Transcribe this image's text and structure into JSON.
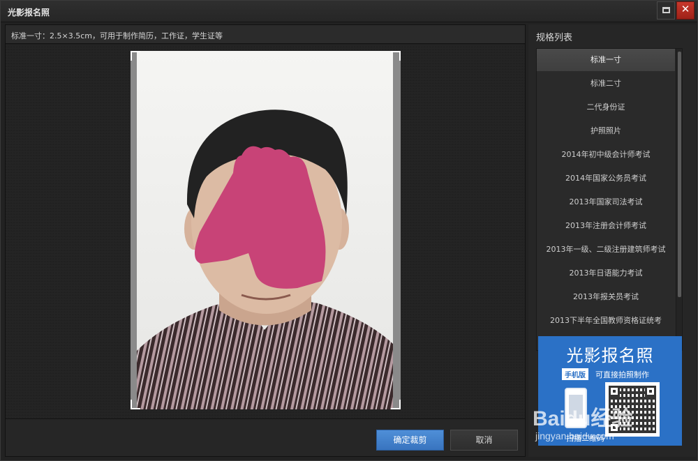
{
  "window": {
    "title": "光影报名照"
  },
  "info_bar": {
    "text": "标准一寸：2.5×3.5cm，可用于制作简历，工作证，学生证等"
  },
  "photo": {
    "subject": "portrait-photo"
  },
  "buttons": {
    "confirm_label": "确定裁剪",
    "cancel_label": "取消"
  },
  "spec_panel": {
    "title": "规格列表",
    "selected_index": 0,
    "items": [
      {
        "label": "标准一寸"
      },
      {
        "label": "标准二寸"
      },
      {
        "label": "二代身份证"
      },
      {
        "label": "护照照片"
      },
      {
        "label": "2014年初中级会计师考试"
      },
      {
        "label": "2014年国家公务员考试"
      },
      {
        "label": "2013年国家司法考试"
      },
      {
        "label": "2013年注册会计师考试"
      },
      {
        "label": "2013年一级、二级注册建筑师考试"
      },
      {
        "label": "2013年日语能力考试"
      },
      {
        "label": "2013年报关员考试"
      },
      {
        "label": "2013下半年全国教师资格证统考"
      }
    ]
  },
  "ad": {
    "title": "光影报名照",
    "tag": "手机版",
    "subtitle": "可直接拍照制作",
    "scan_text": "扫描二维码"
  },
  "watermark": {
    "text": "Baidu经验",
    "sub": "jingyan.baidu.com"
  },
  "colors": {
    "accent": "#3a79c4",
    "ad_background": "#2b71c6",
    "face_mask": "#c84377"
  }
}
